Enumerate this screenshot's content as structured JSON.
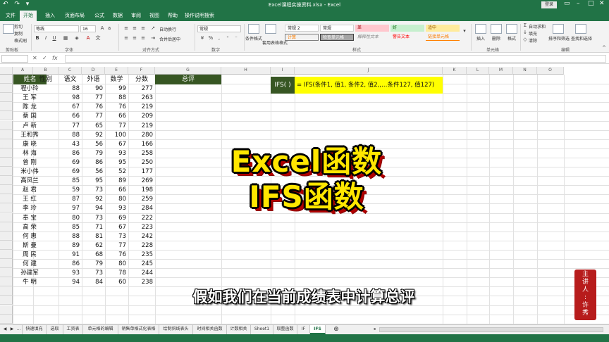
{
  "window": {
    "title": "Excel课程实操资料.xlsx - Excel",
    "login": "登录"
  },
  "ribbon_tabs": [
    "文件",
    "开始",
    "插入",
    "页面布局",
    "公式",
    "数据",
    "审阅",
    "视图",
    "帮助",
    "操作说明搜索"
  ],
  "ribbon": {
    "clipboard": {
      "cut": "剪切",
      "copy": "复制",
      "format_painter": "格式刷",
      "group": "剪贴板"
    },
    "font": {
      "family": "等线",
      "size": "16",
      "group": "字体"
    },
    "alignment": {
      "wrap": "自动换行",
      "merge": "合并后居中",
      "group": "对齐方式"
    },
    "number": {
      "format": "常规",
      "group": "数字"
    },
    "styles": {
      "conditional": "条件格式",
      "table": "套用表格格式",
      "cell_normal2": "常规 2",
      "cell_normal": "常规",
      "cell_bad": "差",
      "cell_good": "好",
      "cell_neutral": "适中",
      "cell_calc": "计算",
      "cell_check": "检查单元格",
      "cell_explain": "解释性文本",
      "cell_warn": "警告文本",
      "cell_link": "链接单元格",
      "group": "样式"
    },
    "cells": {
      "insert": "插入",
      "delete": "删除",
      "format": "格式",
      "group": "单元格"
    },
    "editing": {
      "autosum": "自动求和",
      "fill": "填充",
      "clear": "清除",
      "sort": "排序和筛选",
      "find": "查找和选择",
      "group": "编辑"
    }
  },
  "columns": [
    "A",
    "B",
    "C",
    "D",
    "E",
    "F",
    "G",
    "H",
    "I",
    "J",
    "K",
    "L",
    "M",
    "N",
    "O"
  ],
  "table": {
    "headers": [
      "姓名",
      "性别",
      "语文",
      "外语",
      "数学",
      "分数",
      "总评"
    ],
    "rows": [
      [
        "程小玲",
        "88",
        "90",
        "99",
        "277"
      ],
      [
        "王 军",
        "98",
        "77",
        "88",
        "263"
      ],
      [
        "陈 龙",
        "67",
        "76",
        "76",
        "219"
      ],
      [
        "蔡 国",
        "66",
        "77",
        "66",
        "209"
      ],
      [
        "卢 新",
        "77",
        "65",
        "77",
        "219"
      ],
      [
        "王和秀",
        "88",
        "92",
        "100",
        "280"
      ],
      [
        "康 晓",
        "43",
        "56",
        "67",
        "166"
      ],
      [
        "林 海",
        "86",
        "79",
        "93",
        "258"
      ],
      [
        "曾 刚",
        "69",
        "86",
        "95",
        "250"
      ],
      [
        "米小伟",
        "69",
        "56",
        "52",
        "177"
      ],
      [
        "高凤兰",
        "85",
        "95",
        "89",
        "269"
      ],
      [
        "赵 君",
        "59",
        "73",
        "66",
        "198"
      ],
      [
        "王 红",
        "87",
        "92",
        "80",
        "259"
      ],
      [
        "李 玲",
        "97",
        "94",
        "93",
        "284"
      ],
      [
        "奉 宝",
        "80",
        "73",
        "69",
        "222"
      ],
      [
        "高 荣",
        "85",
        "71",
        "67",
        "223"
      ],
      [
        "何 惠",
        "88",
        "81",
        "73",
        "242"
      ],
      [
        "斯 曼",
        "89",
        "62",
        "77",
        "228"
      ],
      [
        "周 民",
        "91",
        "68",
        "76",
        "235"
      ],
      [
        "何 建",
        "86",
        "79",
        "80",
        "245"
      ],
      [
        "孙建军",
        "93",
        "73",
        "78",
        "244"
      ],
      [
        "牛 明",
        "94",
        "84",
        "60",
        "238"
      ]
    ]
  },
  "ifs": {
    "label": "IFS( )",
    "syntax": "= IFS(条件1, 值1, 条件2, 值2,,…条件127, 值127)"
  },
  "overlay": {
    "title_line1": "Excel函数",
    "title_line2": "IFS函数",
    "subtitle": "假如我们在当前成绩表中计算总评",
    "seal": [
      "主",
      "讲",
      "人",
      ":",
      "许",
      "秀"
    ]
  },
  "sheet_tabs": [
    "...",
    "快速填充",
    "选取",
    "工资表",
    "单元格的编辑",
    "销售单格式化表格",
    "绘制斜线表头",
    "时间相关函数",
    "计数相关",
    "Sheet1",
    "取整函数",
    "IF",
    "IFS"
  ],
  "active_sheet": "IFS",
  "colors": {
    "excel_green": "#217346",
    "header_green": "#375623",
    "highlight_yellow": "#ffff00",
    "title_yellow": "#ffe600",
    "seal_red": "#b71c1c"
  }
}
